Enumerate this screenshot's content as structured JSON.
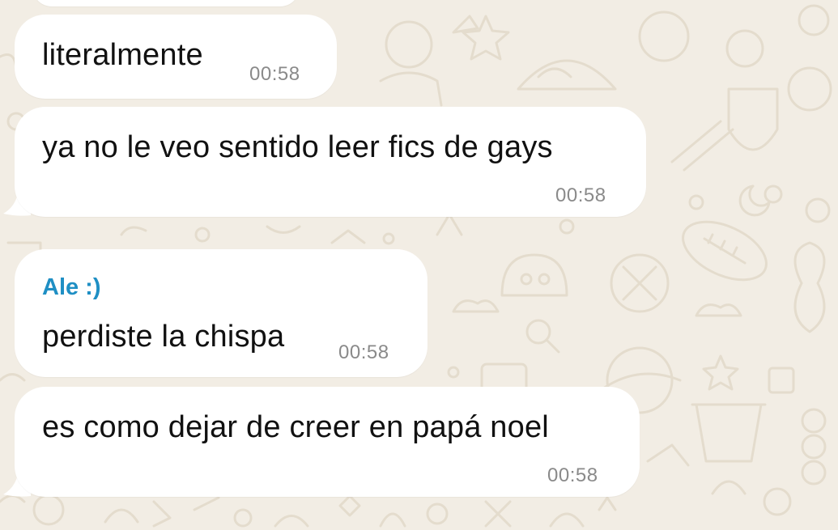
{
  "chat": {
    "wallpaper_color": "#f2ede4",
    "bubble_color": "#ffffff",
    "sender_color": "#1f8fc4",
    "messages": [
      {
        "text": "literalmente",
        "time": "00:58"
      },
      {
        "text": "ya no le veo sentido leer fics de gays",
        "time": "00:58"
      },
      {
        "sender": "Ale :)",
        "text": "perdiste la chispa",
        "time": "00:58"
      },
      {
        "text": "es como dejar de creer en papá noel",
        "time": "00:58"
      }
    ]
  }
}
